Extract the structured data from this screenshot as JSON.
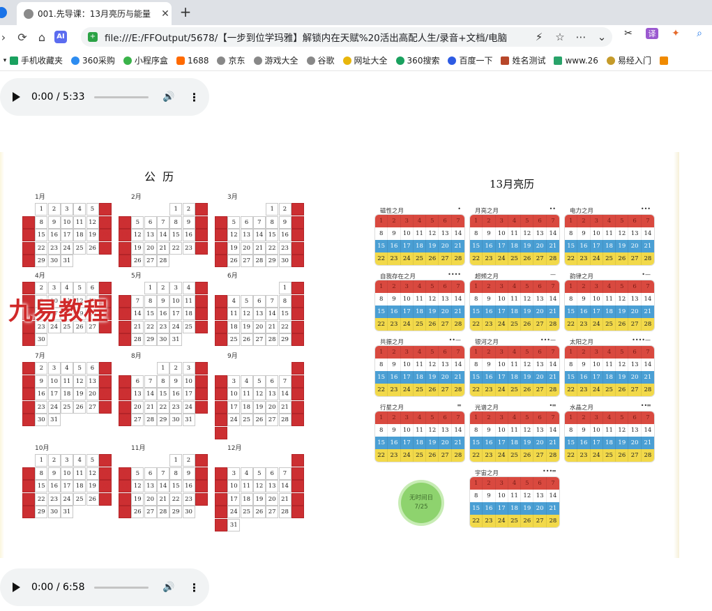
{
  "browser": {
    "tab_title": "001.先导课：13月亮历与能量",
    "url": "file:///E:/FFOutput/5678/【一步到位学玛雅】解锁内在天赋%20活出高配人生/录音+文档/电脑",
    "bookmarks": [
      "手机收藏夹",
      "360采购",
      "小程序盒",
      "1688",
      "京东",
      "游戏大全",
      "谷歌",
      "网址大全",
      "360搜索",
      "百度一下",
      "姓名测试",
      "www.26",
      "易经入门"
    ]
  },
  "audio_top": {
    "time": "0:00 / 5:33"
  },
  "audio_bottom": {
    "time": "0:00 / 6:58"
  },
  "gregorian": {
    "title": "公  历",
    "months": [
      {
        "name": "1月",
        "start": 1,
        "days": 31
      },
      {
        "name": "2月",
        "start": 4,
        "days": 28
      },
      {
        "name": "3月",
        "start": 4,
        "days": 31
      },
      {
        "name": "4月",
        "start": 0,
        "days": 30
      },
      {
        "name": "5月",
        "start": 2,
        "days": 31
      },
      {
        "name": "6月",
        "start": 5,
        "days": 30
      },
      {
        "name": "7月",
        "start": 0,
        "days": 31
      },
      {
        "name": "8月",
        "start": 3,
        "days": 31
      },
      {
        "name": "9月",
        "start": 6,
        "days": 30
      },
      {
        "name": "10月",
        "start": 1,
        "days": 31
      },
      {
        "name": "11月",
        "start": 4,
        "days": 30
      },
      {
        "name": "12月",
        "start": 6,
        "days": 31
      }
    ]
  },
  "moon": {
    "title": "13月亮历",
    "months": [
      {
        "name": "磁性之月",
        "sym": "•"
      },
      {
        "name": "月亮之月",
        "sym": "••"
      },
      {
        "name": "电力之月",
        "sym": "•••"
      },
      {
        "name": "自我存在之月",
        "sym": "••••"
      },
      {
        "name": "超频之月",
        "sym": "—"
      },
      {
        "name": "韵律之月",
        "sym": "•—"
      },
      {
        "name": "共振之月",
        "sym": "••—"
      },
      {
        "name": "银河之月",
        "sym": "•••—"
      },
      {
        "name": "太阳之月",
        "sym": "••••—"
      },
      {
        "name": "行星之月",
        "sym": "═"
      },
      {
        "name": "光谱之月",
        "sym": "•═"
      },
      {
        "name": "水晶之月",
        "sym": "••═"
      },
      {
        "name": "宇宙之月",
        "sym": "•••═"
      }
    ],
    "row_colors": [
      "#d9493f",
      "#ffffff",
      "#4a9fd4",
      "#f2d94a"
    ],
    "badge_line1": "无时间日",
    "badge_line2": "7/25"
  },
  "watermark": "九易教程"
}
